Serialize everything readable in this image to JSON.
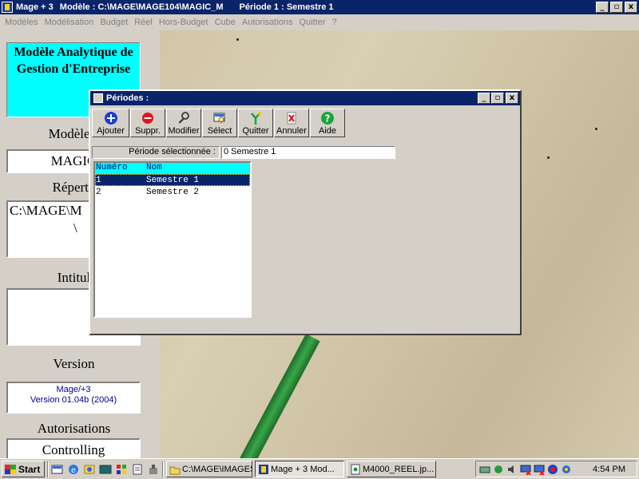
{
  "app": {
    "title": "Mage + 3",
    "model": "Modèle : C:\\MAGE\\MAGE104\\MAGIC_M",
    "period": "Période  1 : Semestre 1",
    "window_buttons": [
      "_",
      "▫",
      "x"
    ]
  },
  "menu": [
    "Modèles",
    "Modélisation",
    "Budget",
    "Réel",
    "Hors-Budget",
    "Cube",
    "Autorisations",
    "Quitter",
    "?"
  ],
  "left_panel": {
    "model_title": "Modèle Analytique de Gestion d'Entreprise",
    "label_model": "Modèle a",
    "model_value": "MAGIC",
    "label_repertoire": "Réperto",
    "repertoire_value": "C:\\MAGE\\M",
    "repertoire_value2": "\\",
    "label_intitule": "Intitul",
    "intitule_value": "",
    "label_version": "Version",
    "version_line1": "Mage/+3",
    "version_line2": "Version 01.04b (2004)",
    "label_autorisations": "Autorisations",
    "autorisations_value": "Controlling"
  },
  "dialog": {
    "title": "Périodes :",
    "toolbar": [
      {
        "label": "Ajouter",
        "icon": "add-icon"
      },
      {
        "label": "Suppr.",
        "icon": "delete-icon"
      },
      {
        "label": "Modifier",
        "icon": "wrench-icon"
      },
      {
        "label": "Sélect",
        "icon": "select-icon"
      },
      {
        "label": "Quitter",
        "icon": "exit-icon"
      },
      {
        "label": "Annuler",
        "icon": "cancel-icon"
      },
      {
        "label": "Aide",
        "icon": "help-icon"
      }
    ],
    "selected_label": "Période sélectionnée :",
    "selected_value": "0  Semestre 1",
    "grid": {
      "columns": [
        "Numéro",
        "Nom"
      ],
      "rows": [
        {
          "num": "1",
          "nom": "Semestre 1",
          "selected": true
        },
        {
          "num": "2",
          "nom": "Semestre 2",
          "selected": false
        }
      ]
    }
  },
  "taskbar": {
    "start": "Start",
    "tasks": [
      "C:\\MAGE\\IMAGES",
      "Mage + 3   Mod...",
      "M4000_REEL.jp..."
    ],
    "clock": "4:54 PM"
  },
  "colors": {
    "titlebar": "#0a246a",
    "accent_cyan": "#00ffff",
    "face": "#d4d0c8"
  }
}
